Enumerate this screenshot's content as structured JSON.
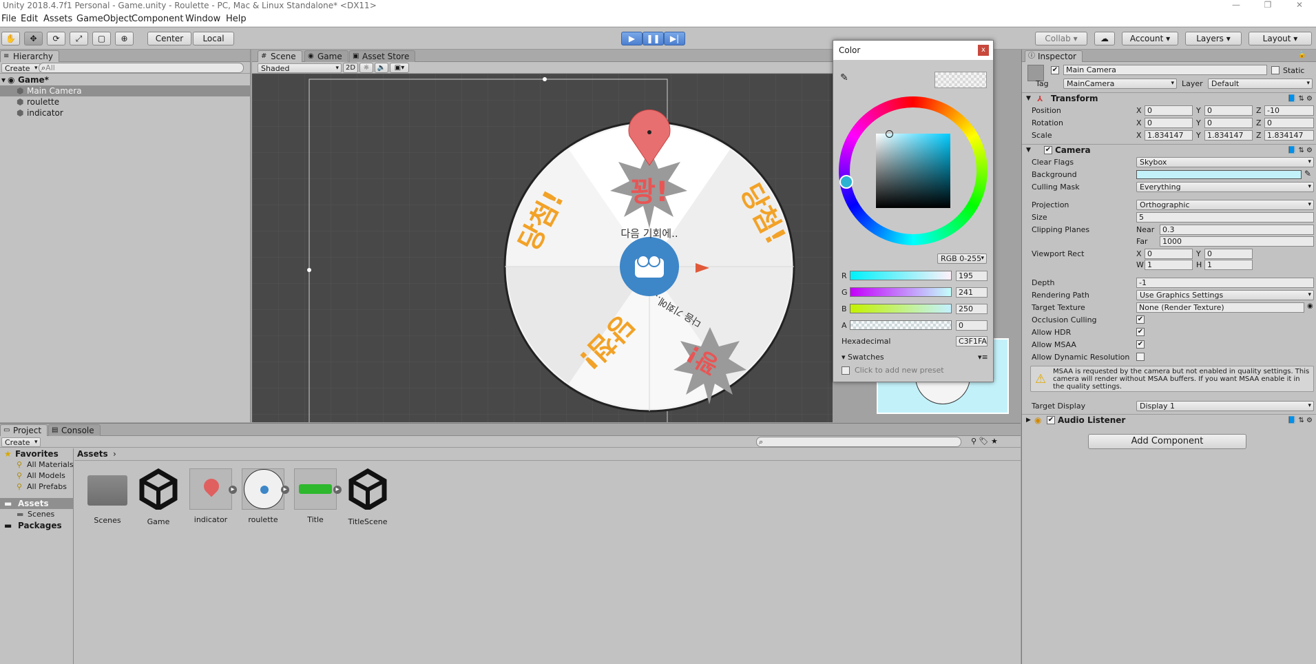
{
  "window": {
    "title": "Unity 2018.4.7f1 Personal - Game.unity - Roulette - PC, Mac & Linux Standalone* <DX11>"
  },
  "menu": [
    "File",
    "Edit",
    "Assets",
    "GameObject",
    "Component",
    "Window",
    "Help"
  ],
  "toolbar": {
    "pivot": "Center",
    "space": "Local",
    "collab": "Collab",
    "account": "Account",
    "layers": "Layers",
    "layout": "Layout"
  },
  "hierarchy": {
    "tab": "Hierarchy",
    "create": "Create",
    "search_placeholder": "All",
    "scene": "Game*",
    "items": [
      "Main Camera",
      "roulette",
      "indicator"
    ]
  },
  "scene": {
    "tabs": [
      "Scene",
      "Game",
      "Asset Store"
    ],
    "shading": "Shaded",
    "mode2d": "2D",
    "wheel_labels": {
      "top": "꽝!",
      "next_top": "다음 기회에..",
      "right": "당첨!",
      "left": "당첨!",
      "bottom_left": "당첨!",
      "bottom_right": "꽝!",
      "next_bottom": "다음 기회에.."
    }
  },
  "color_picker": {
    "title": "Color",
    "mode": "RGB 0-255",
    "channels": [
      {
        "label": "R",
        "value": "195"
      },
      {
        "label": "G",
        "value": "241"
      },
      {
        "label": "B",
        "value": "250"
      },
      {
        "label": "A",
        "value": "0"
      }
    ],
    "hex_label": "Hexadecimal",
    "hex_value": "C3F1FA",
    "swatches": "Swatches",
    "add_preset": "Click to add new preset",
    "color": "#C3F1FA"
  },
  "inspector": {
    "tab": "Inspector",
    "object_name": "Main Camera",
    "static": "Static",
    "tag_label": "Tag",
    "tag": "MainCamera",
    "layer_label": "Layer",
    "layer": "Default",
    "transform": {
      "title": "Transform",
      "rows": [
        {
          "label": "Position",
          "x": "0",
          "y": "0",
          "z": "-10"
        },
        {
          "label": "Rotation",
          "x": "0",
          "y": "0",
          "z": "0"
        },
        {
          "label": "Scale",
          "x": "1.834147",
          "y": "1.834147",
          "z": "1.834147"
        }
      ]
    },
    "camera": {
      "title": "Camera",
      "clear_flags_label": "Clear Flags",
      "clear_flags": "Skybox",
      "background_label": "Background",
      "culling_mask_label": "Culling Mask",
      "culling_mask": "Everything",
      "projection_label": "Projection",
      "projection": "Orthographic",
      "size_label": "Size",
      "size": "5",
      "clipping_label": "Clipping Planes",
      "near_label": "Near",
      "near": "0.3",
      "far_label": "Far",
      "far": "1000",
      "viewport_label": "Viewport Rect",
      "vx": "0",
      "vy": "0",
      "vw": "1",
      "vh": "1",
      "depth_label": "Depth",
      "depth": "-1",
      "rendering_path_label": "Rendering Path",
      "rendering_path": "Use Graphics Settings",
      "target_texture_label": "Target Texture",
      "target_texture": "None (Render Texture)",
      "occlusion_label": "Occlusion Culling",
      "hdr_label": "Allow HDR",
      "msaa_label": "Allow MSAA",
      "dynres_label": "Allow Dynamic Resolution",
      "warning": "MSAA is requested by the camera but not enabled in quality settings. This camera will render without MSAA buffers. If you want MSAA enable it in the quality settings.",
      "target_display_label": "Target Display",
      "target_display": "Display 1"
    },
    "audio_listener": "Audio Listener",
    "add_component": "Add Component"
  },
  "project": {
    "tabs": [
      "Project",
      "Console"
    ],
    "create": "Create",
    "favorites": "Favorites",
    "favorite_items": [
      "All Materials",
      "All Models",
      "All Prefabs"
    ],
    "assets_root": "Assets",
    "asset_folders": [
      "Scenes"
    ],
    "packages": "Packages",
    "breadcrumb": "Assets",
    "assets": [
      "Scenes",
      "Game",
      "indicator",
      "roulette",
      "Title",
      "TitleScene"
    ]
  }
}
